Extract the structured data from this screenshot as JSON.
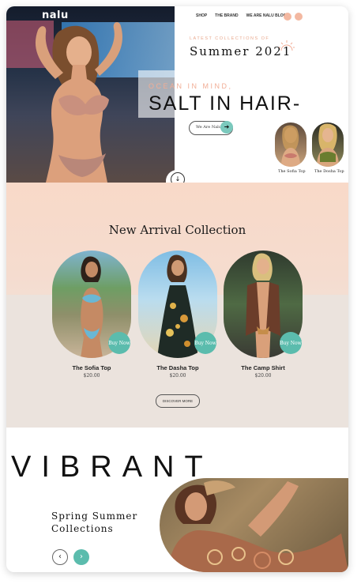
{
  "brand": {
    "logo": "nalu"
  },
  "nav": {
    "items": [
      "SHOP",
      "THE BRAND",
      "WE ARE NALU BLOG"
    ]
  },
  "hero": {
    "latest_label": "LATEST COLLECTIONS OF",
    "season_title": "Summer 2021",
    "tagline_top": "OCEAN IN MIND,",
    "tagline_main": "SALT IN HAIR-",
    "cta_label": "We Are Nalu",
    "thumbs": [
      {
        "label": "The Sofia Top"
      },
      {
        "label": "The Dosha Top"
      }
    ],
    "scroll_label": "SCROLL DOWN"
  },
  "arrivals": {
    "title": "New Arrival Collection",
    "buy_label": "Buy Now",
    "products": [
      {
        "name": "The Sofia Top",
        "price": "$20.00"
      },
      {
        "name": "The Dasha Top",
        "price": "$20.00"
      },
      {
        "name": "The Camp Shirt",
        "price": "$20.00"
      }
    ],
    "discover_label": "DISCOVER MORE"
  },
  "vibrant": {
    "title": "VIBRANT",
    "subtitle_line1": "Spring Summer",
    "subtitle_line2": "Collections"
  },
  "colors": {
    "accent_teal": "#5bbcad",
    "accent_peach": "#f1ad95",
    "text_dark": "#111111"
  },
  "icons": {
    "cta": "arrow-right-icon",
    "scroll": "arrow-down-icon",
    "prev": "chevron-left-icon",
    "next": "chevron-right-icon"
  }
}
